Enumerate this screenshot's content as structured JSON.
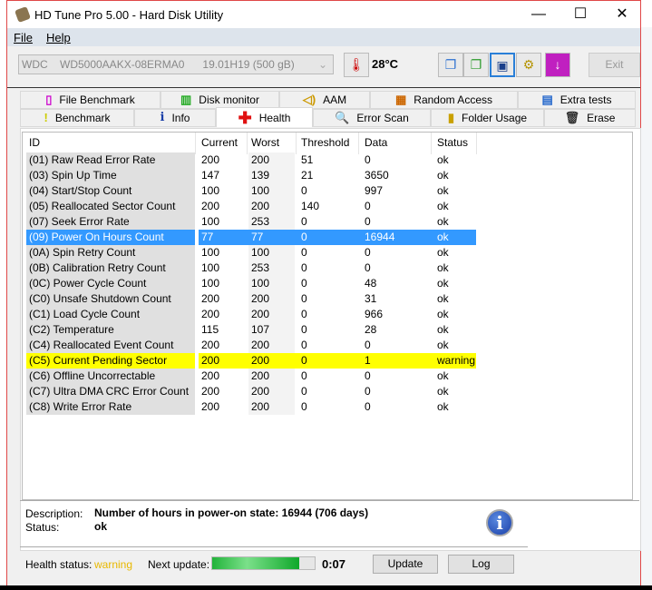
{
  "window": {
    "title": "HD Tune Pro 5.00 - Hard Disk Utility",
    "minimize": "—",
    "maximize": "☐",
    "close": "✕"
  },
  "menu": [
    "File",
    "Help"
  ],
  "toolbar": {
    "drive": "WDC    WD5000AAKX-08ERMA0      19.01H19 (500 gB)",
    "temperature": "28°C",
    "exit": "Exit"
  },
  "tabs_top": [
    {
      "label": "File Benchmark",
      "icon": "file-benchmark-icon"
    },
    {
      "label": "Disk monitor",
      "icon": "disk-monitor-icon"
    },
    {
      "label": "AAM",
      "icon": "speaker-icon"
    },
    {
      "label": "Random Access",
      "icon": "random-access-icon"
    },
    {
      "label": "Extra tests",
      "icon": "extra-tests-icon"
    }
  ],
  "tabs_bottom": [
    {
      "label": "Benchmark",
      "icon": "exclamation-icon"
    },
    {
      "label": "Info",
      "icon": "info-icon"
    },
    {
      "label": "Health",
      "icon": "red-cross-icon"
    },
    {
      "label": "Error Scan",
      "icon": "magnifier-icon"
    },
    {
      "label": "Folder Usage",
      "icon": "folder-icon"
    },
    {
      "label": "Erase",
      "icon": "trash-icon"
    }
  ],
  "table": {
    "headers": [
      "ID",
      "Current",
      "Worst",
      "Threshold",
      "Data",
      "Status"
    ],
    "rows": [
      [
        "(01) Raw Read Error Rate",
        "200",
        "200",
        "51",
        "0",
        "ok"
      ],
      [
        "(03) Spin Up Time",
        "147",
        "139",
        "21",
        "3650",
        "ok"
      ],
      [
        "(04) Start/Stop Count",
        "100",
        "100",
        "0",
        "997",
        "ok"
      ],
      [
        "(05) Reallocated Sector Count",
        "200",
        "200",
        "140",
        "0",
        "ok"
      ],
      [
        "(07) Seek Error Rate",
        "100",
        "253",
        "0",
        "0",
        "ok"
      ],
      [
        "(09) Power On Hours Count",
        "77",
        "77",
        "0",
        "16944",
        "ok"
      ],
      [
        "(0A) Spin Retry Count",
        "100",
        "100",
        "0",
        "0",
        "ok"
      ],
      [
        "(0B) Calibration Retry Count",
        "100",
        "253",
        "0",
        "0",
        "ok"
      ],
      [
        "(0C) Power Cycle Count",
        "100",
        "100",
        "0",
        "48",
        "ok"
      ],
      [
        "(C0) Unsafe Shutdown Count",
        "200",
        "200",
        "0",
        "31",
        "ok"
      ],
      [
        "(C1) Load Cycle Count",
        "200",
        "200",
        "0",
        "966",
        "ok"
      ],
      [
        "(C2) Temperature",
        "115",
        "107",
        "0",
        "28",
        "ok"
      ],
      [
        "(C4) Reallocated Event Count",
        "200",
        "200",
        "0",
        "0",
        "ok"
      ],
      [
        "(C5) Current Pending Sector",
        "200",
        "200",
        "0",
        "1",
        "warning"
      ],
      [
        "(C6) Offline Uncorrectable",
        "200",
        "200",
        "0",
        "0",
        "ok"
      ],
      [
        "(C7) Ultra DMA CRC Error Count",
        "200",
        "200",
        "0",
        "0",
        "ok"
      ],
      [
        "(C8) Write Error Rate",
        "200",
        "200",
        "0",
        "0",
        "ok"
      ]
    ],
    "selected_row": 5,
    "warning_row": 13
  },
  "details": {
    "description_label": "Description:",
    "description": "Number of hours in power-on state: 16944 (706 days)",
    "status_label": "Status:",
    "status": "ok"
  },
  "footer": {
    "health_label": "Health status:",
    "health": "warning",
    "next_update_label": "Next update:",
    "progress_percent": 85,
    "countdown": "0:07",
    "update": "Update",
    "log": "Log"
  },
  "colors": {
    "selected": "#3399ff",
    "warning": "#ffff00",
    "health_warning": "#e8b800"
  }
}
